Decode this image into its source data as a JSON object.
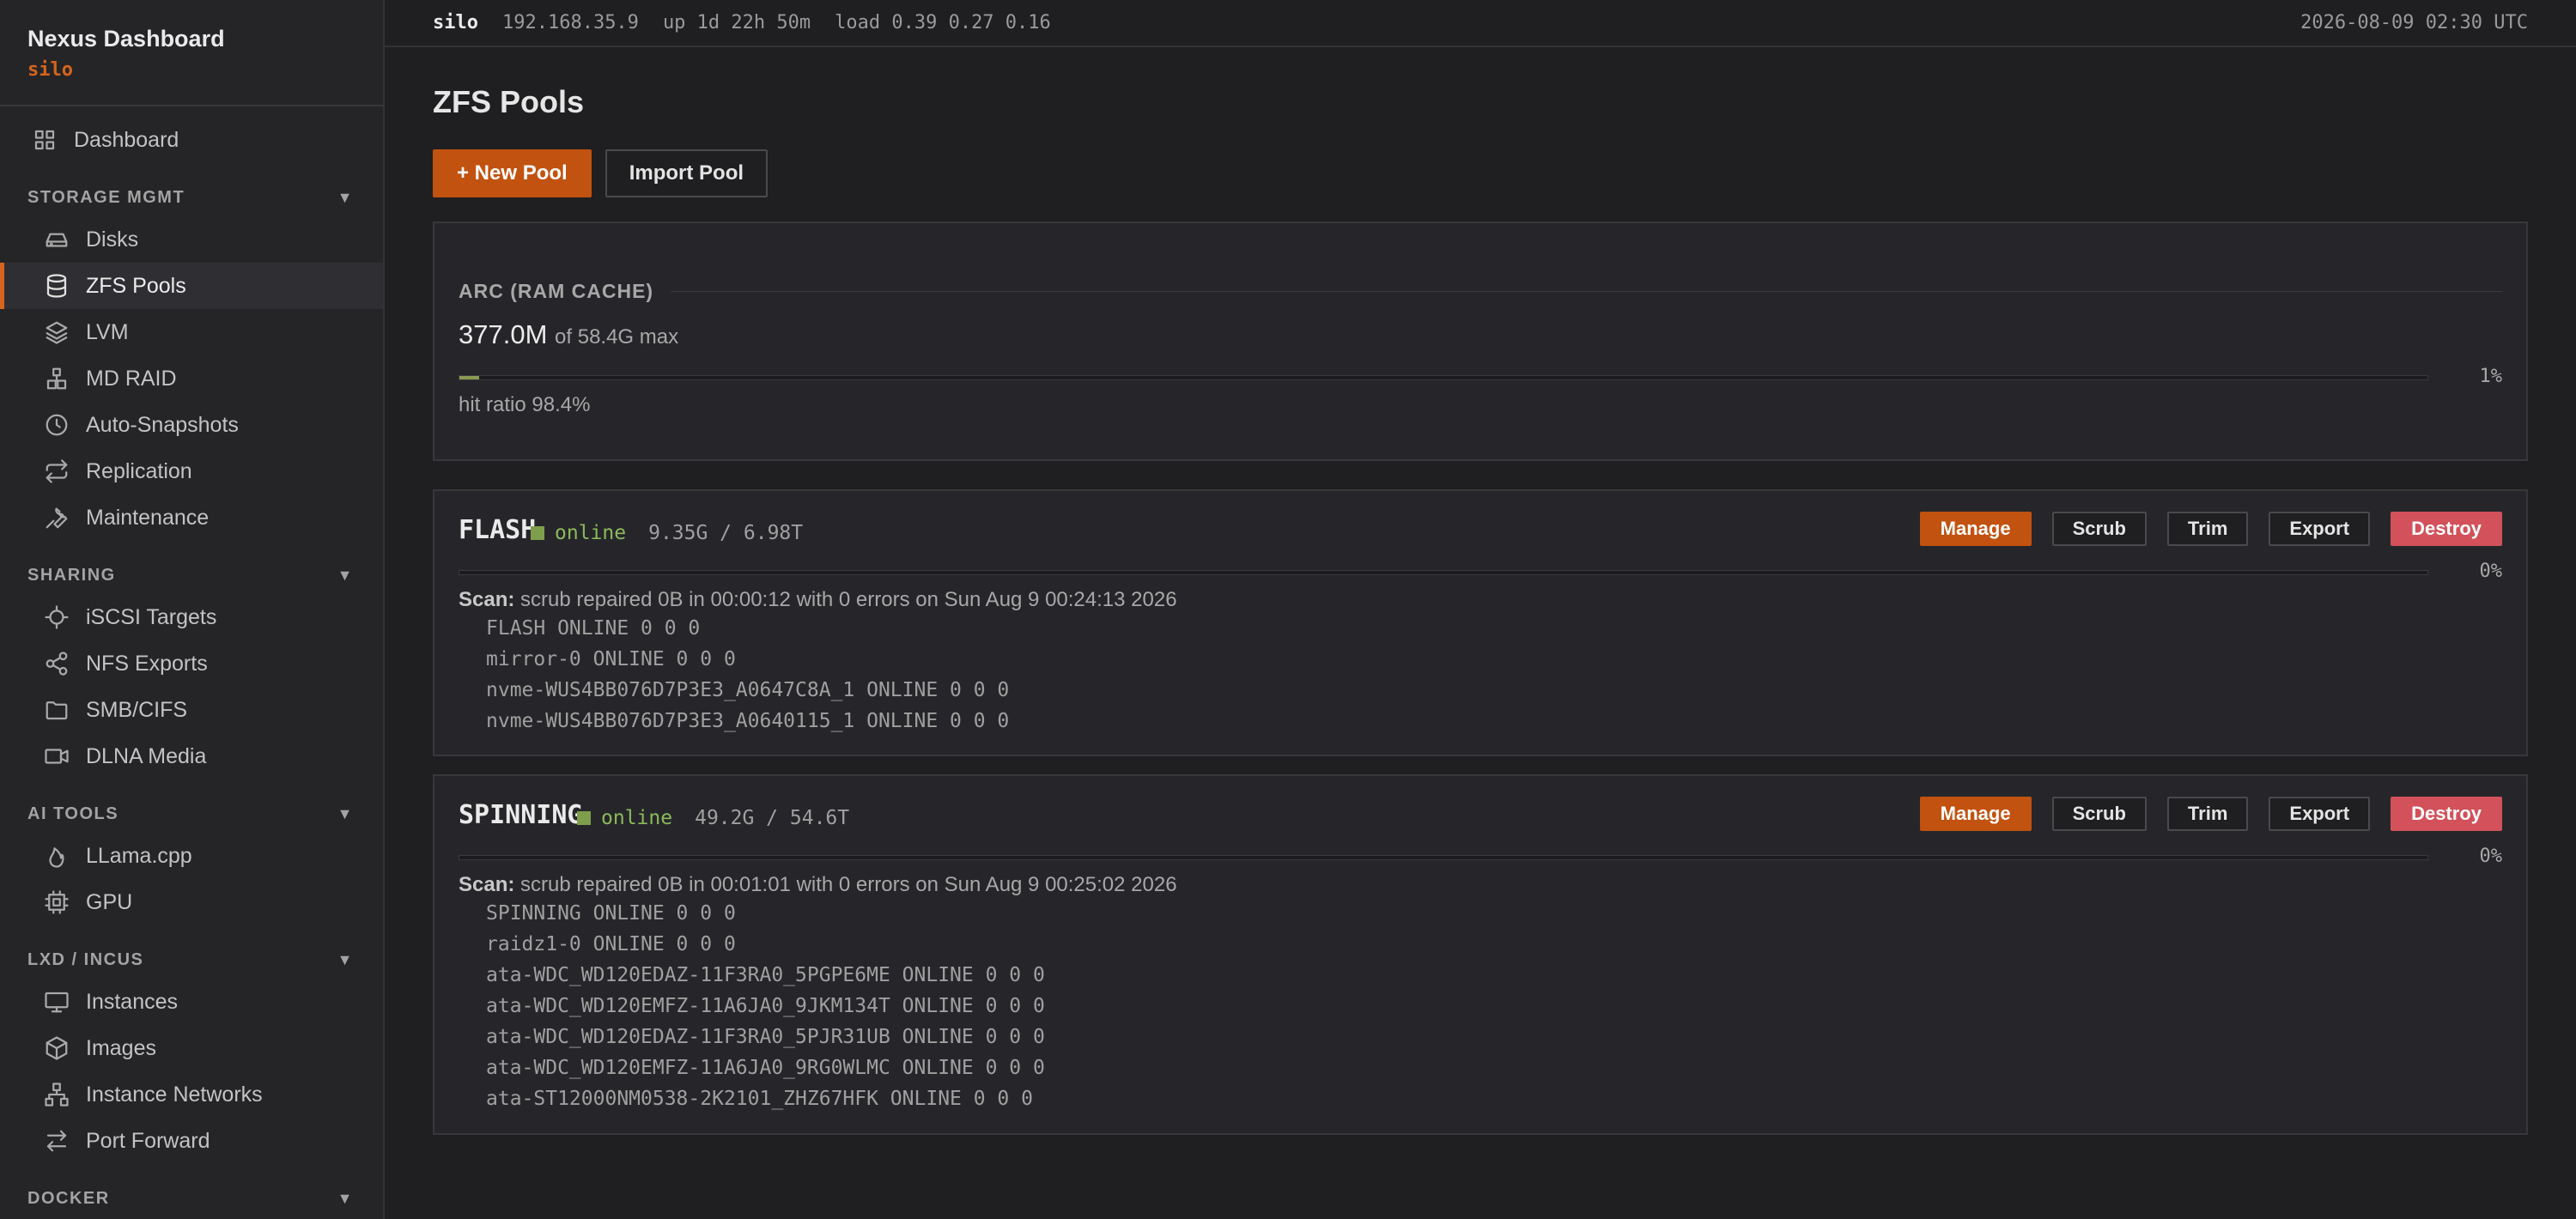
{
  "brand": {
    "title": "Nexus Dashboard",
    "host": "silo"
  },
  "nav": {
    "dashboard": "Dashboard",
    "sections": {
      "storage": "STORAGE MGMT",
      "sharing": "SHARING",
      "ai": "AI TOOLS",
      "lxd": "LXD / INCUS",
      "docker": "DOCKER"
    },
    "storage_items": [
      "Disks",
      "ZFS Pools",
      "LVM",
      "MD RAID",
      "Auto-Snapshots",
      "Replication",
      "Maintenance"
    ],
    "sharing_items": [
      "iSCSI Targets",
      "NFS Exports",
      "SMB/CIFS",
      "DLNA Media"
    ],
    "ai_items": [
      "LLama.cpp",
      "GPU"
    ],
    "lxd_items": [
      "Instances",
      "Images",
      "Instance Networks",
      "Port Forward"
    ],
    "active": "ZFS Pools"
  },
  "topbar": {
    "host": "silo",
    "ip": "192.168.35.9",
    "uptime": "up 1d 22h 50m",
    "load": "load 0.39 0.27 0.16",
    "time": "2026-08-09 02:30 UTC"
  },
  "page": {
    "title": "ZFS Pools",
    "new_pool": "+ New Pool",
    "import_pool": "Import Pool"
  },
  "arc": {
    "heading": "ARC (RAM CACHE)",
    "used": "377.0M",
    "max": "of 58.4G max",
    "percent_label": "1%",
    "percent": 0.01,
    "hit_ratio": "hit ratio 98.4%"
  },
  "pools": [
    {
      "name": "FLASH",
      "status": "online",
      "usage": "9.35G / 6.98T",
      "percent_label": "0%",
      "scan_label": "Scan:",
      "scan": "scrub repaired 0B in 00:00:12 with 0 errors on Sun Aug 9 00:24:13 2026",
      "vdevs": [
        "FLASH ONLINE 0 0 0",
        "mirror-0 ONLINE 0 0 0",
        "nvme-WUS4BB076D7P3E3_A0647C8A_1 ONLINE 0 0 0",
        "nvme-WUS4BB076D7P3E3_A0640115_1 ONLINE 0 0 0"
      ]
    },
    {
      "name": "SPINNING",
      "status": "online",
      "usage": "49.2G / 54.6T",
      "percent_label": "0%",
      "scan_label": "Scan:",
      "scan": "scrub repaired 0B in 00:01:01 with 0 errors on Sun Aug 9 00:25:02 2026",
      "vdevs": [
        "SPINNING ONLINE 0 0 0",
        "raidz1-0 ONLINE 0 0 0",
        "ata-WDC_WD120EDAZ-11F3RA0_5PGPE6ME ONLINE 0 0 0",
        "ata-WDC_WD120EMFZ-11A6JA0_9JKM134T ONLINE 0 0 0",
        "ata-WDC_WD120EDAZ-11F3RA0_5PJR31UB ONLINE 0 0 0",
        "ata-WDC_WD120EMFZ-11A6JA0_9RG0WLMC ONLINE 0 0 0",
        "ata-ST12000NM0538-2K2101_ZHZ67HFK ONLINE 0 0 0"
      ]
    }
  ],
  "pool_actions": {
    "manage": "Manage",
    "scrub": "Scrub",
    "trim": "Trim",
    "export": "Export",
    "destroy": "Destroy"
  },
  "colors": {
    "accent": "#c2520f",
    "online": "#8cba5a",
    "destroy": "#d2515a"
  }
}
